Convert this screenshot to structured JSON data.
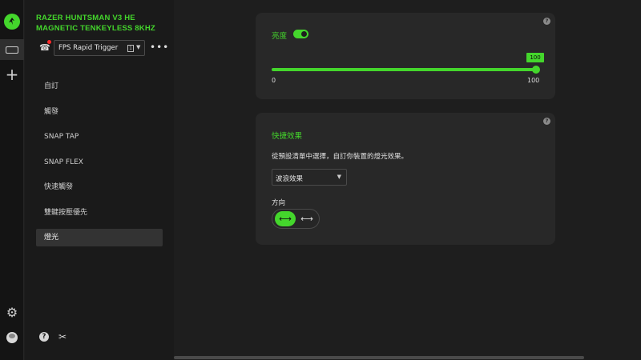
{
  "device": {
    "title": "RAZER HUNTSMAN V3 HE MAGNETIC TENKEYLESS 8KHZ"
  },
  "profile": {
    "name": "FPS Rapid Trigger",
    "slot": "1",
    "more": "•••"
  },
  "nav": {
    "items": [
      {
        "label": "自訂"
      },
      {
        "label": "觸發"
      },
      {
        "label": "SNAP TAP"
      },
      {
        "label": "SNAP FLEX"
      },
      {
        "label": "快速觸發"
      },
      {
        "label": "雙鍵按壓優先"
      },
      {
        "label": "燈光"
      }
    ],
    "active_index": 6
  },
  "brightness": {
    "label": "亮度",
    "enabled": true,
    "value": "100",
    "value_num": 100,
    "min": "0",
    "max": "100"
  },
  "quick_effects": {
    "title": "快捷效果",
    "description": "從預設清單中選擇，自訂你裝置的燈光效果。",
    "selected_effect": "波浪效果",
    "direction_label": "方向",
    "direction_options": [
      "left-right-arrows-icon",
      "right-arrows-icon"
    ],
    "selected_direction": 0
  },
  "colors": {
    "accent": "#44d62c",
    "background": "#1e1e1e",
    "card": "#282828"
  }
}
